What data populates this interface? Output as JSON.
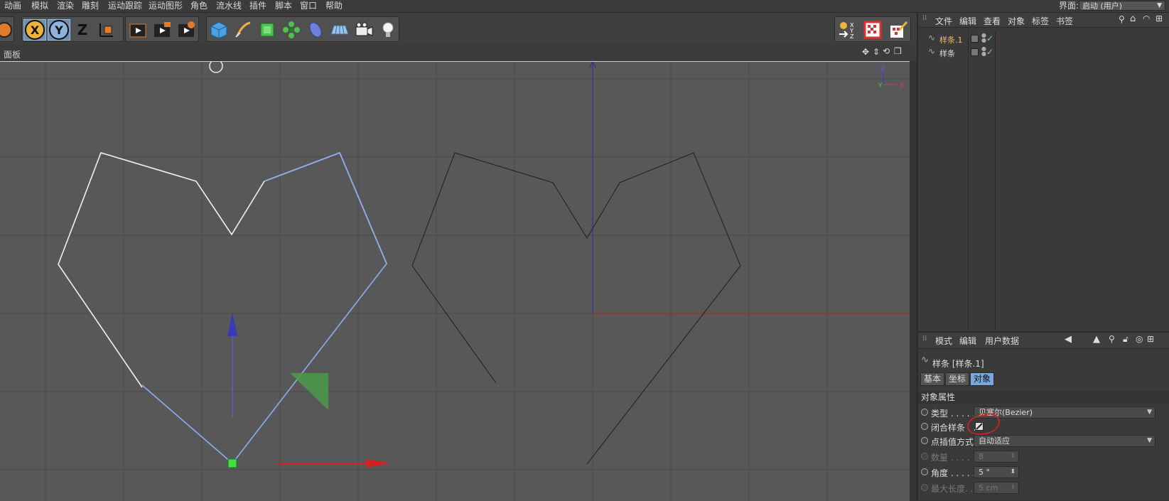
{
  "menubar": {
    "items": [
      "动画",
      "模拟",
      "渲染",
      "雕刻",
      "运动跟踪",
      "运动图形",
      "角色",
      "流水线",
      "插件",
      "脚本",
      "窗口",
      "帮助"
    ],
    "layout_label": "界面:",
    "layout_value": "启动 (用户)"
  },
  "toolbar": {
    "axis_x": "X",
    "axis_y": "Y",
    "axis_z": "Z",
    "icons": [
      "selection-icon",
      "x-axis-lock",
      "y-axis-lock",
      "z-axis-lock",
      "coordinate-system-icon",
      "render-view-icon",
      "render-picture-viewer-icon",
      "render-settings-icon",
      "cube-icon",
      "pen-icon",
      "subdivision-icon",
      "mograph-cloner-icon",
      "deformer-icon",
      "floor-icon",
      "camera-icon",
      "light-icon"
    ]
  },
  "viewport": {
    "panel_label": "面板",
    "axis_labels": {
      "z": "Z",
      "y": "Y",
      "x": "X"
    }
  },
  "object_manager": {
    "menu": [
      "文件",
      "编辑",
      "查看",
      "对象",
      "标签",
      "书签"
    ],
    "objects": [
      {
        "name": "样条.1",
        "selected": true
      },
      {
        "name": "样条",
        "selected": false
      }
    ]
  },
  "attribute_manager": {
    "menu": [
      "模式",
      "编辑",
      "用户数据"
    ],
    "title": "样条 [样条.1]",
    "tabs": [
      "基本",
      "坐标",
      "对象"
    ],
    "active_tab": "对象",
    "section": "对象属性",
    "properties": [
      {
        "label": "类型 . . . . .",
        "value": "贝塞尔(Bezier)",
        "kind": "dropdown",
        "enabled": true
      },
      {
        "label": "闭合样条 . .",
        "value": "",
        "kind": "checkbox",
        "enabled": true
      },
      {
        "label": "点插值方式",
        "value": "自动适应",
        "kind": "dropdown",
        "enabled": true
      },
      {
        "label": "数量 . . . . .",
        "value": "8",
        "kind": "stepper",
        "enabled": false
      },
      {
        "label": "角度 . . . . .",
        "value": "5 °",
        "kind": "stepper",
        "enabled": true
      },
      {
        "label": "最大长度. . .",
        "value": "5 cm",
        "kind": "stepper",
        "enabled": false
      }
    ]
  },
  "colors": {
    "accent_selected": "#7aa7dd",
    "selected_object_text": "#f0c040",
    "annotation_red": "#e02020"
  }
}
